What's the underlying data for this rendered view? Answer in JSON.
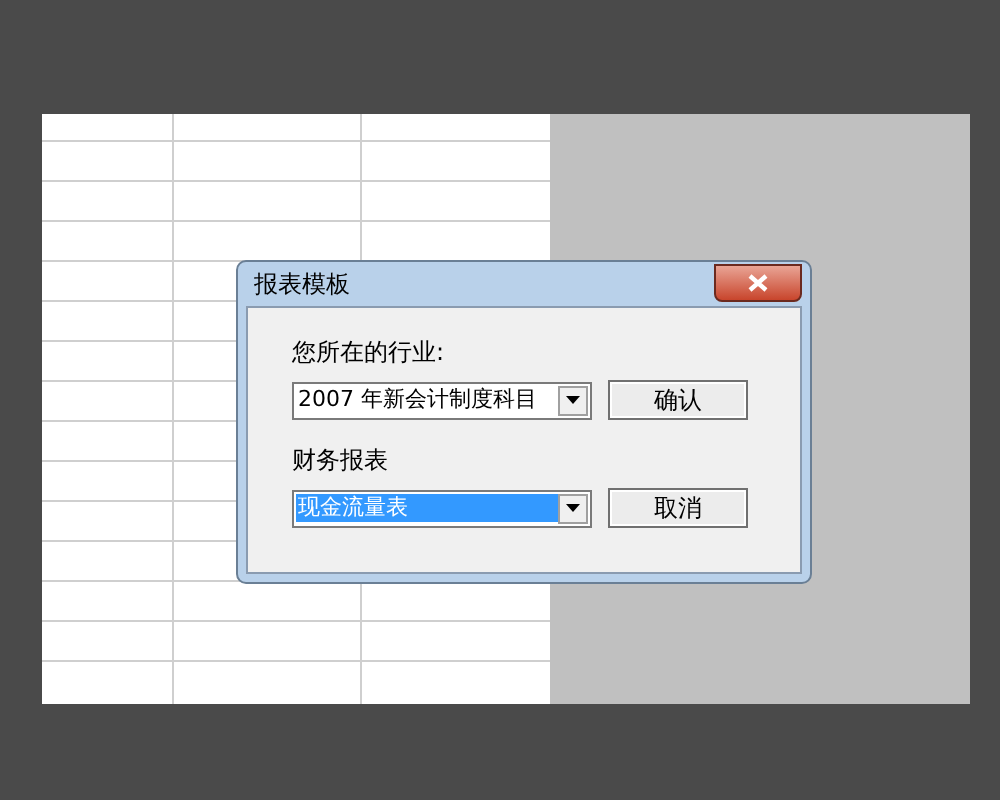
{
  "dialog": {
    "title": "报表模板",
    "fields": [
      {
        "label": "您所在的行业:",
        "value": "2007 年新会计制度科目",
        "selected": false,
        "button": "确认"
      },
      {
        "label": "财务报表",
        "value": "现金流量表",
        "selected": true,
        "button": "取消"
      }
    ]
  }
}
